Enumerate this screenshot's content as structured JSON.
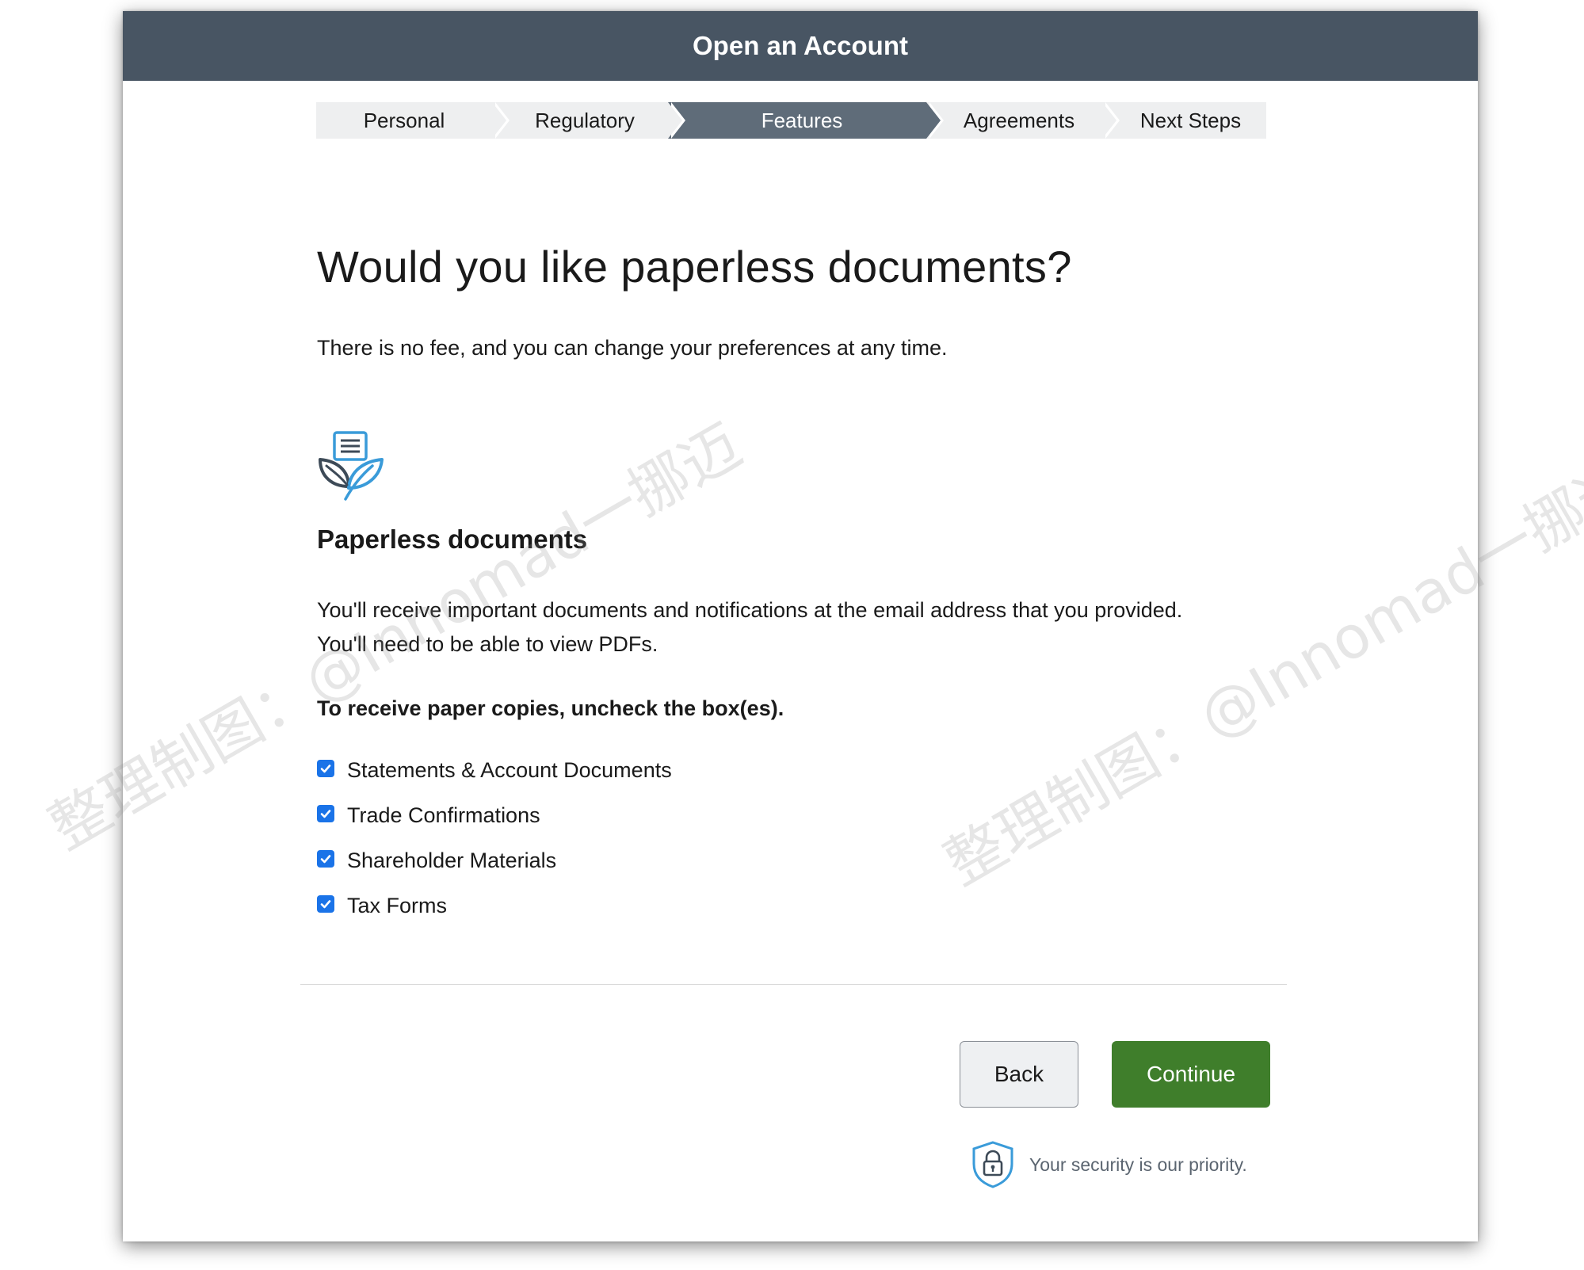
{
  "window": {
    "title": "Open an Account"
  },
  "stepper": {
    "steps": [
      {
        "label": "Personal",
        "active": false
      },
      {
        "label": "Regulatory",
        "active": false
      },
      {
        "label": "Features",
        "active": true
      },
      {
        "label": "Agreements",
        "active": false
      },
      {
        "label": "Next Steps",
        "active": false
      }
    ]
  },
  "main": {
    "heading": "Would you like paperless documents?",
    "subtext": "There is no fee, and you can change your preferences at any time.",
    "feature": {
      "icon": "paperless-leaf-document-icon",
      "title": "Paperless documents",
      "description_line1": "You'll receive important documents and notifications at the email address that you provided.",
      "description_line2": "You'll need to be able to view PDFs."
    },
    "instruction": "To receive paper copies, uncheck the box(es).",
    "checkboxes": [
      {
        "label": "Statements & Account Documents",
        "checked": true
      },
      {
        "label": "Trade Confirmations",
        "checked": true
      },
      {
        "label": "Shareholder Materials",
        "checked": true
      },
      {
        "label": "Tax Forms",
        "checked": true
      }
    ]
  },
  "footer": {
    "back_label": "Back",
    "continue_label": "Continue",
    "security_text": "Your security is our priority.",
    "security_icon": "shield-lock-icon"
  },
  "watermarks": [
    "整理制图：@Innomad一挪迈",
    "整理制图：@Innomad一挪迈"
  ],
  "colors": {
    "titlebar": "#485563",
    "active_step": "#5f6c79",
    "inactive_step": "#eeeff0",
    "checkbox": "#1a73e8",
    "continue_button": "#3f7e2b",
    "icon_blue": "#3a9bd9",
    "icon_dark": "#3d4a57"
  }
}
